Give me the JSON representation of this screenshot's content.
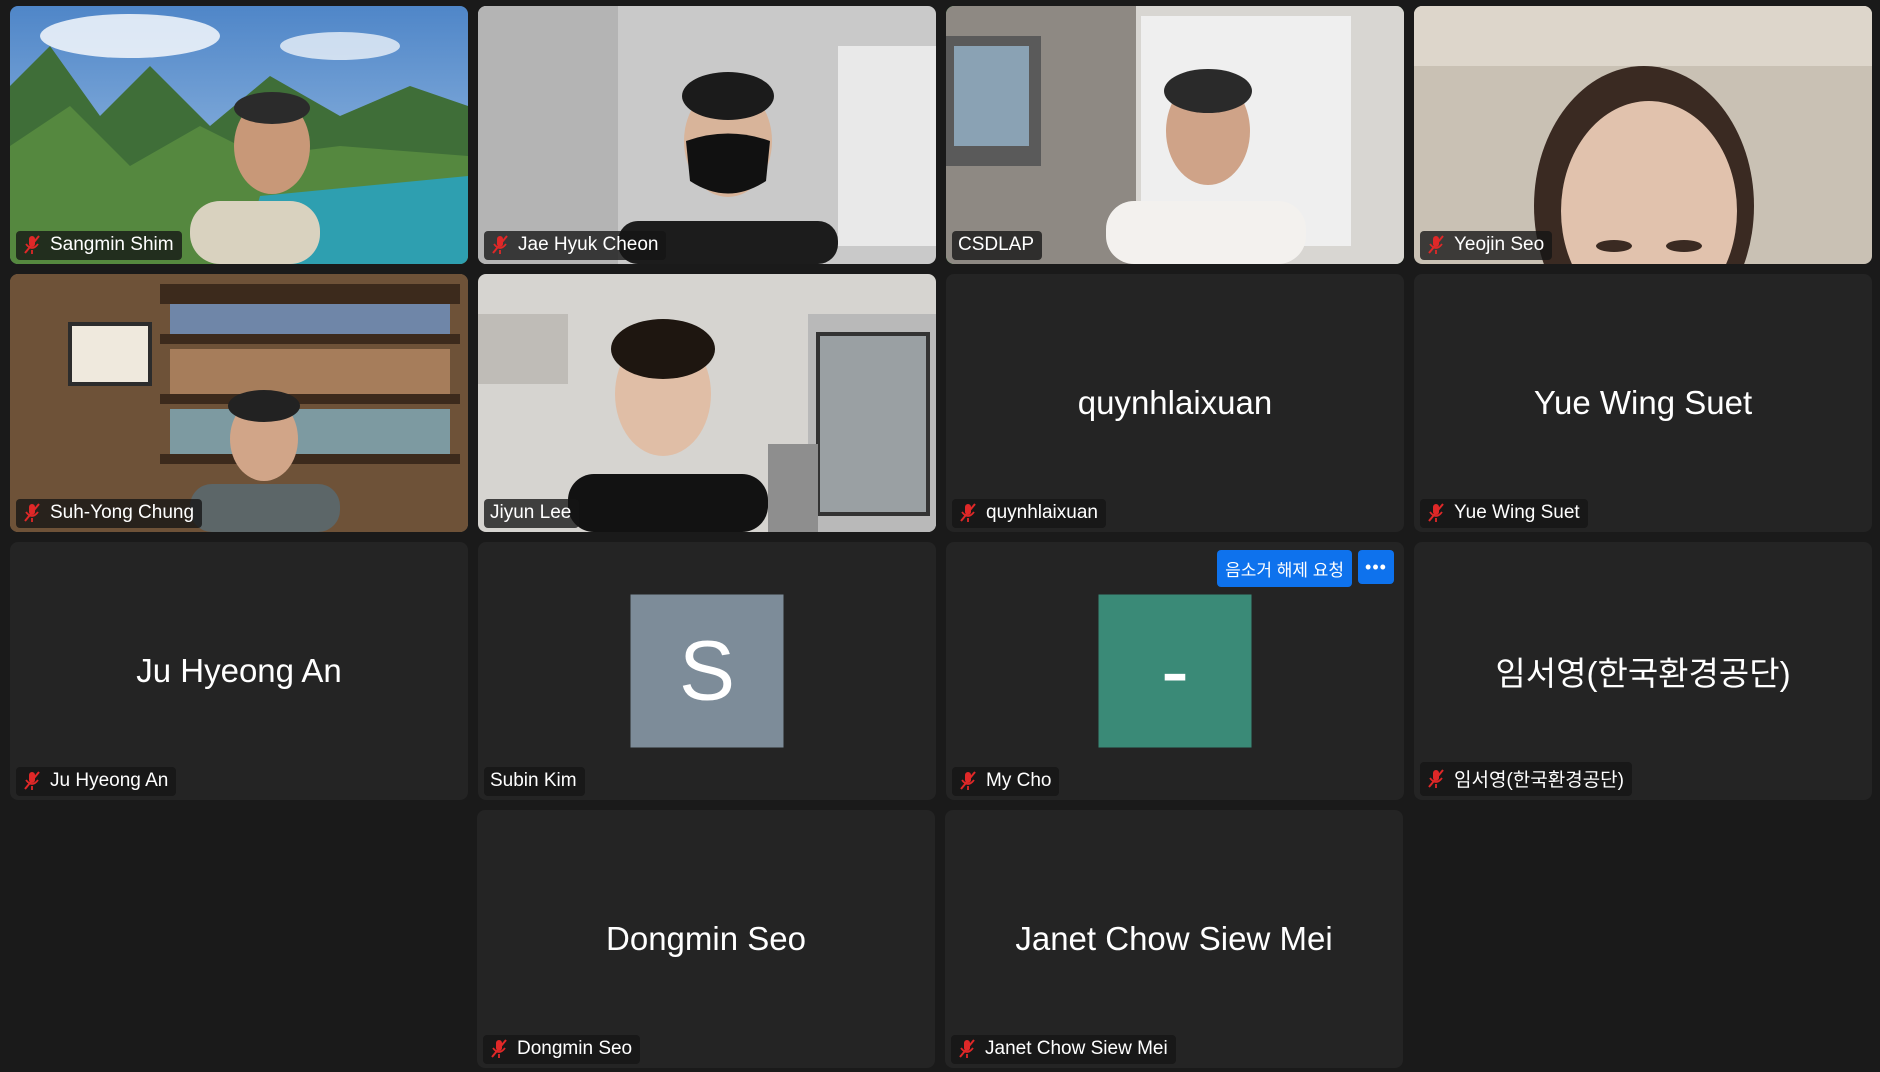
{
  "participants": [
    {
      "name": "Sangmin Shim",
      "muted": true
    },
    {
      "name": "Jae Hyuk Cheon",
      "muted": true
    },
    {
      "name": "CSDLAP",
      "muted": false,
      "speaking": true
    },
    {
      "name": "Yeojin Seo",
      "muted": true
    },
    {
      "name": "Suh-Yong Chung",
      "muted": true
    },
    {
      "name": "Jiyun Lee",
      "muted": false
    },
    {
      "name": "quynhlaixuan",
      "muted": true,
      "center_name": "quynhlaixuan"
    },
    {
      "name": "Yue Wing Suet",
      "muted": true,
      "center_name": "Yue Wing Suet"
    },
    {
      "name": "Ju Hyeong An",
      "muted": true,
      "center_name": "Ju Hyeong An"
    },
    {
      "name": "Subin Kim",
      "muted": false,
      "avatar_letter": "S",
      "avatar_color": "#7d8c99"
    },
    {
      "name": "My Cho",
      "muted": true,
      "avatar_letter": "-",
      "avatar_color": "#3a8a77",
      "unmute_request_label": "음소거 해제 요청",
      "more_label": "•••"
    },
    {
      "name": "임서영(한국환경공단)",
      "muted": true,
      "center_name": "임서영(한국환경공단)"
    },
    {
      "name": "Dongmin Seo",
      "muted": true,
      "center_name": "Dongmin Seo"
    },
    {
      "name": "Janet Chow Siew Mei",
      "muted": true,
      "center_name": "Janet Chow Siew Mei"
    }
  ],
  "colors": {
    "active_border": "#4ccf5b",
    "muted_icon": "#e02828",
    "button_blue": "#0e72ed"
  }
}
